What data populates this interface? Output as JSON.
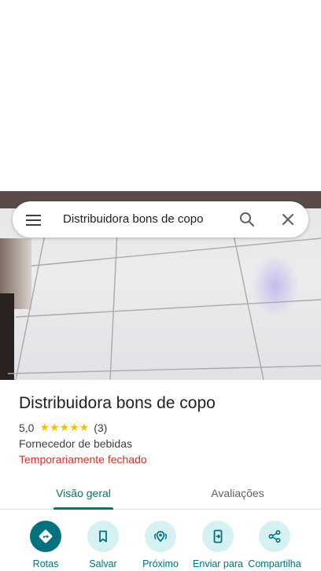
{
  "search": {
    "query": "Distribuidora bons de copo"
  },
  "place": {
    "name": "Distribuidora bons de copo",
    "rating": "5,0",
    "stars": "★★★★★",
    "review_count": "(3)",
    "category": "Fornecedor de bebidas",
    "status": "Temporariamente fechado"
  },
  "tabs": [
    {
      "label": "Visão geral",
      "active": true
    },
    {
      "label": "Avaliações",
      "active": false
    }
  ],
  "actions": [
    {
      "label": "Rotas",
      "icon": "directions-icon"
    },
    {
      "label": "Salvar",
      "icon": "bookmark-icon"
    },
    {
      "label": "Próximo",
      "icon": "nearby-icon"
    },
    {
      "label": "Enviar para",
      "icon": "send-to-phone-icon"
    },
    {
      "label": "Compartilha",
      "icon": "share-icon"
    }
  ],
  "colors": {
    "accent": "#00796b",
    "action_bg": "#d6f1f2",
    "primary_action": "#00727f",
    "stars": "#fbbc04",
    "closed_status": "#d93025"
  }
}
